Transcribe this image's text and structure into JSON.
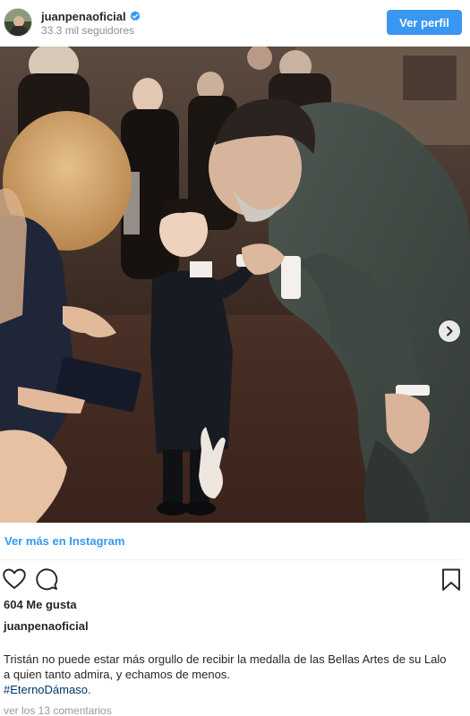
{
  "header": {
    "username": "juanpenaoficial",
    "followers": "33.3 mil seguidores",
    "view_profile_label": "Ver perfil",
    "avatar_icon": "profile-avatar",
    "verified_icon": "verified-badge-icon",
    "verified_color": "#3897f0"
  },
  "post": {
    "image_icon": "photo-next-chevron-icon",
    "view_more_label": "Ver más en Instagram",
    "likes": "604 Me gusta",
    "caption_username": "juanpenaoficial",
    "caption_text": "Tristán no puede estar más orgullo de recibir la medalla de las Bellas Artes de su Lalo a quien tanto admira, y echamos de menos.",
    "hashtag": "#EternoDámaso.",
    "comments_link": "ver los 13 comentarios",
    "accent_color": "#3897f0"
  },
  "actions": {
    "like_icon": "heart-icon",
    "comment_icon": "comment-icon",
    "save_icon": "bookmark-icon"
  }
}
